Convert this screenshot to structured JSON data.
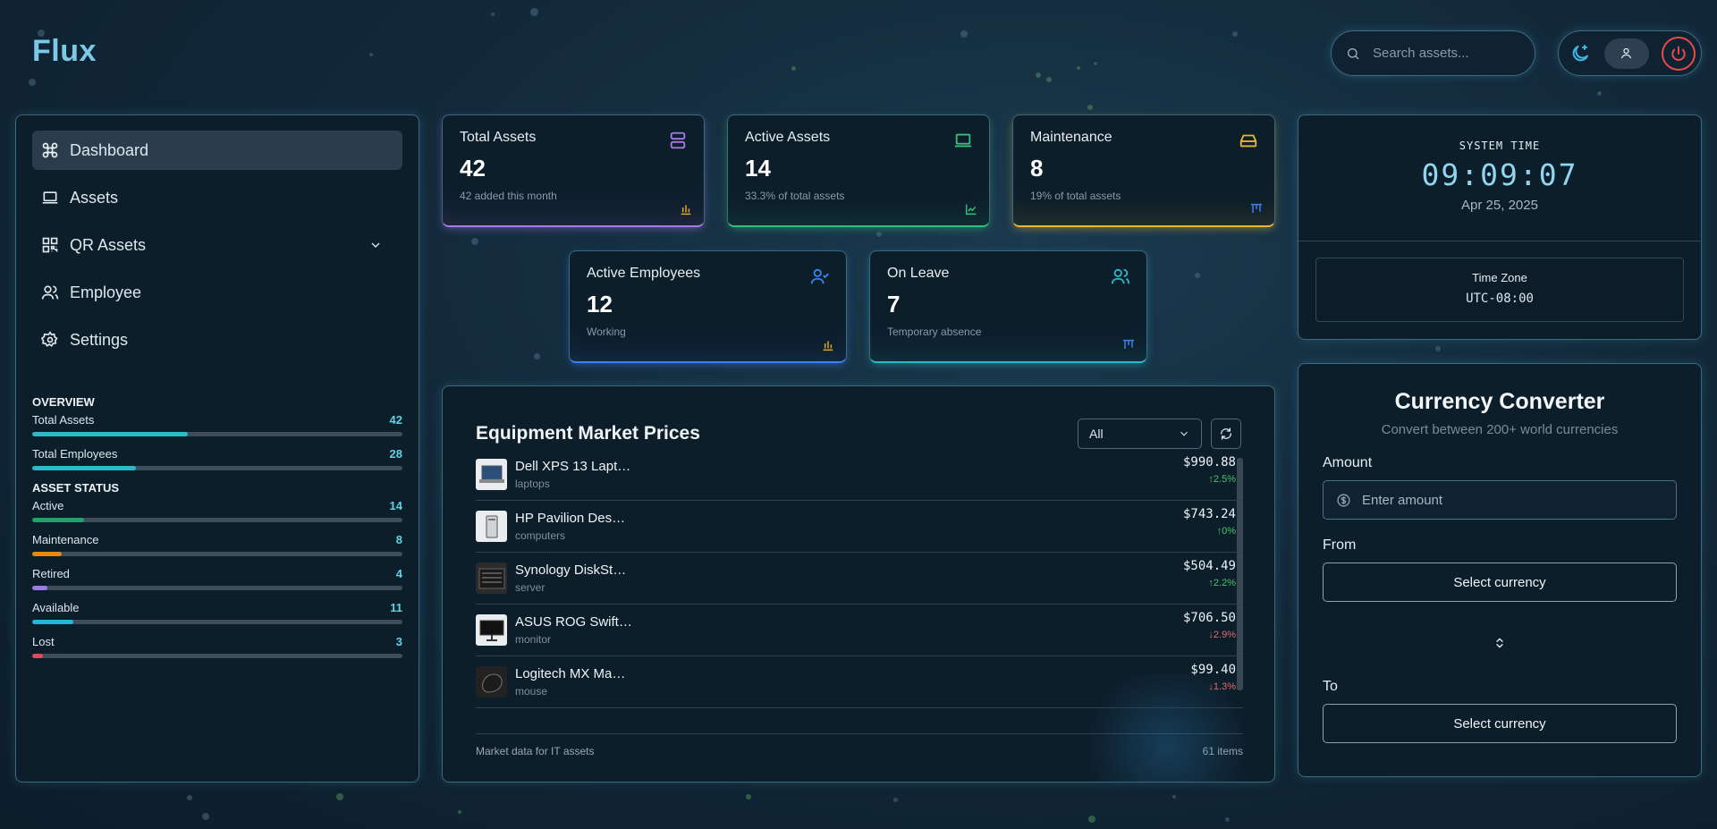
{
  "app": {
    "logo": "Flux"
  },
  "search": {
    "placeholder": "Search assets..."
  },
  "toolbar": {
    "theme_icon": "moon-star-icon",
    "user_icon": "user-icon",
    "power_icon": "power-icon"
  },
  "sidebar": {
    "nav": [
      {
        "label": "Dashboard",
        "icon": "command-icon",
        "active": true
      },
      {
        "label": "Assets",
        "icon": "laptop-icon"
      },
      {
        "label": "QR Assets",
        "icon": "qr-code-icon",
        "expandable": true
      },
      {
        "label": "Employee",
        "icon": "users-icon"
      },
      {
        "label": "Settings",
        "icon": "gear-icon"
      }
    ],
    "overview_title": "OVERVIEW",
    "overview": [
      {
        "label": "Total Assets",
        "value": "42",
        "fill": 0.42,
        "color": "#2bb8c8"
      },
      {
        "label": "Total Employees",
        "value": "28",
        "fill": 0.28,
        "color": "#2bb8c8"
      }
    ],
    "status_title": "ASSET STATUS",
    "status": [
      {
        "label": "Active",
        "value": "14",
        "fill": 0.14,
        "color": "#1fa36a"
      },
      {
        "label": "Maintenance",
        "value": "8",
        "fill": 0.08,
        "color": "#e8890f"
      },
      {
        "label": "Retired",
        "value": "4",
        "fill": 0.04,
        "color": "#9b7be8"
      },
      {
        "label": "Available",
        "value": "11",
        "fill": 0.11,
        "color": "#22b6d9"
      },
      {
        "label": "Lost",
        "value": "3",
        "fill": 0.03,
        "color": "#e5485a"
      }
    ]
  },
  "cards": [
    {
      "title": "Total Assets",
      "value": "42",
      "sub": "42 added this month",
      "accent": "#a979e6",
      "icon": "server-icon",
      "mini": "bar-chart-icon",
      "mini_color": "#e0a820"
    },
    {
      "title": "Active Assets",
      "value": "14",
      "sub": "33.3% of total assets",
      "accent": "#34c07a",
      "icon": "laptop-icon",
      "mini": "line-chart-icon",
      "mini_color": "#34c07a"
    },
    {
      "title": "Maintenance",
      "value": "8",
      "sub": "19% of total assets",
      "accent": "#e7b730",
      "icon": "hard-drive-icon",
      "mini": "kanban-chart-icon",
      "mini_color": "#3b82f6"
    },
    {
      "title": "Active Employees",
      "value": "12",
      "sub": "Working",
      "accent": "#3b82f6",
      "icon": "user-check-icon",
      "mini": "bar-chart-icon",
      "mini_color": "#e0a820"
    },
    {
      "title": "On Leave",
      "value": "7",
      "sub": "Temporary absence",
      "accent": "#2bb8c8",
      "icon": "users-icon",
      "mini": "kanban-chart-icon",
      "mini_color": "#3b82f6"
    }
  ],
  "market": {
    "title": "Equipment Market Prices",
    "filter": "All",
    "items": [
      {
        "name": "Dell XPS 13 Lapt…",
        "category": "laptops",
        "price": "$990.88",
        "change": "2.5%",
        "dir": "up"
      },
      {
        "name": "HP Pavilion Des…",
        "category": "computers",
        "price": "$743.24",
        "change": "0%",
        "dir": "up"
      },
      {
        "name": "Synology DiskSt…",
        "category": "server",
        "price": "$504.49",
        "change": "2.2%",
        "dir": "up"
      },
      {
        "name": "ASUS ROG Swift…",
        "category": "monitor",
        "price": "$706.50",
        "change": "2.9%",
        "dir": "down"
      },
      {
        "name": "Logitech MX Ma…",
        "category": "mouse",
        "price": "$99.40",
        "change": "1.3%",
        "dir": "down"
      }
    ],
    "footer_left": "Market data for IT assets",
    "footer_right": "61 items"
  },
  "clock": {
    "label": "SYSTEM TIME",
    "time": "09:09:07",
    "date": "Apr 25, 2025",
    "tz_label": "Time Zone",
    "tz_value": "UTC-08:00"
  },
  "currency": {
    "title": "Currency Converter",
    "subtitle": "Convert between 200+ world currencies",
    "amount_label": "Amount",
    "amount_placeholder": "Enter amount",
    "from_label": "From",
    "from_value": "Select currency",
    "to_label": "To",
    "to_value": "Select currency"
  }
}
